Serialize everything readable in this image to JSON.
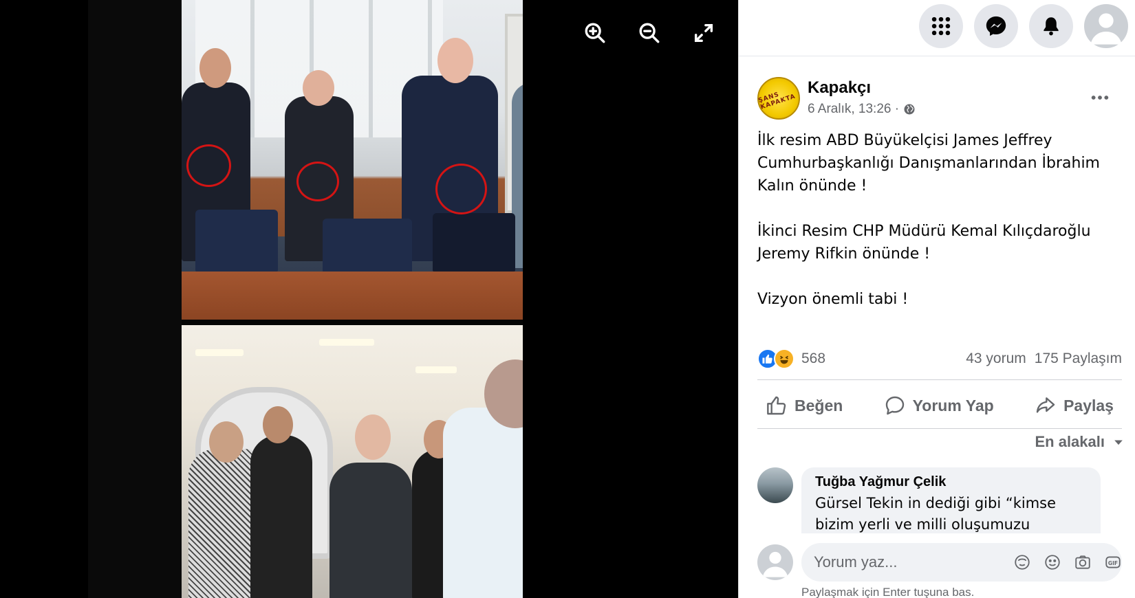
{
  "viewer": {
    "controls": [
      {
        "name": "zoom-in-icon"
      },
      {
        "name": "zoom-out-icon"
      },
      {
        "name": "fullscreen-icon"
      }
    ]
  },
  "topbar": {
    "icons": [
      "menu-grid-icon",
      "messenger-icon",
      "notifications-bell-icon",
      "profile-avatar-icon"
    ]
  },
  "post": {
    "page_name": "Kapakçı",
    "logo_text": "ŞANS KAPAKTA",
    "time": "6 Aralık, 13:26 ·",
    "paragraphs": [
      "İlk resim ABD Büyükelçisi James Jeffrey Cumhurbaşkanlığı Danışmanlarından İbrahim Kalın önünde !",
      "İkinci Resim CHP Müdürü Kemal Kılıçdaroğlu Jeremy Rifkin önünde !",
      "Vizyon önemli tabi !"
    ],
    "reaction_count": "568",
    "comments_count": "43 yorum",
    "shares_count": "175 Paylaşım"
  },
  "actions": {
    "like": "Beğen",
    "comment": "Yorum Yap",
    "share": "Paylaş"
  },
  "sort_label": "En alakalı",
  "comment": {
    "author": "Tuğba Yağmur Çelik",
    "text": "Gürsel Tekin in dediği gibi “kimse bizim yerli ve milli oluşumuzu"
  },
  "composer": {
    "placeholder": "Yorum yaz...",
    "hint": "Paylaşmak için Enter tuşuna bas."
  },
  "colors": {
    "accent": "#1877f2",
    "secondary_text": "#65676b",
    "bubble_bg": "#f0f2f5"
  }
}
